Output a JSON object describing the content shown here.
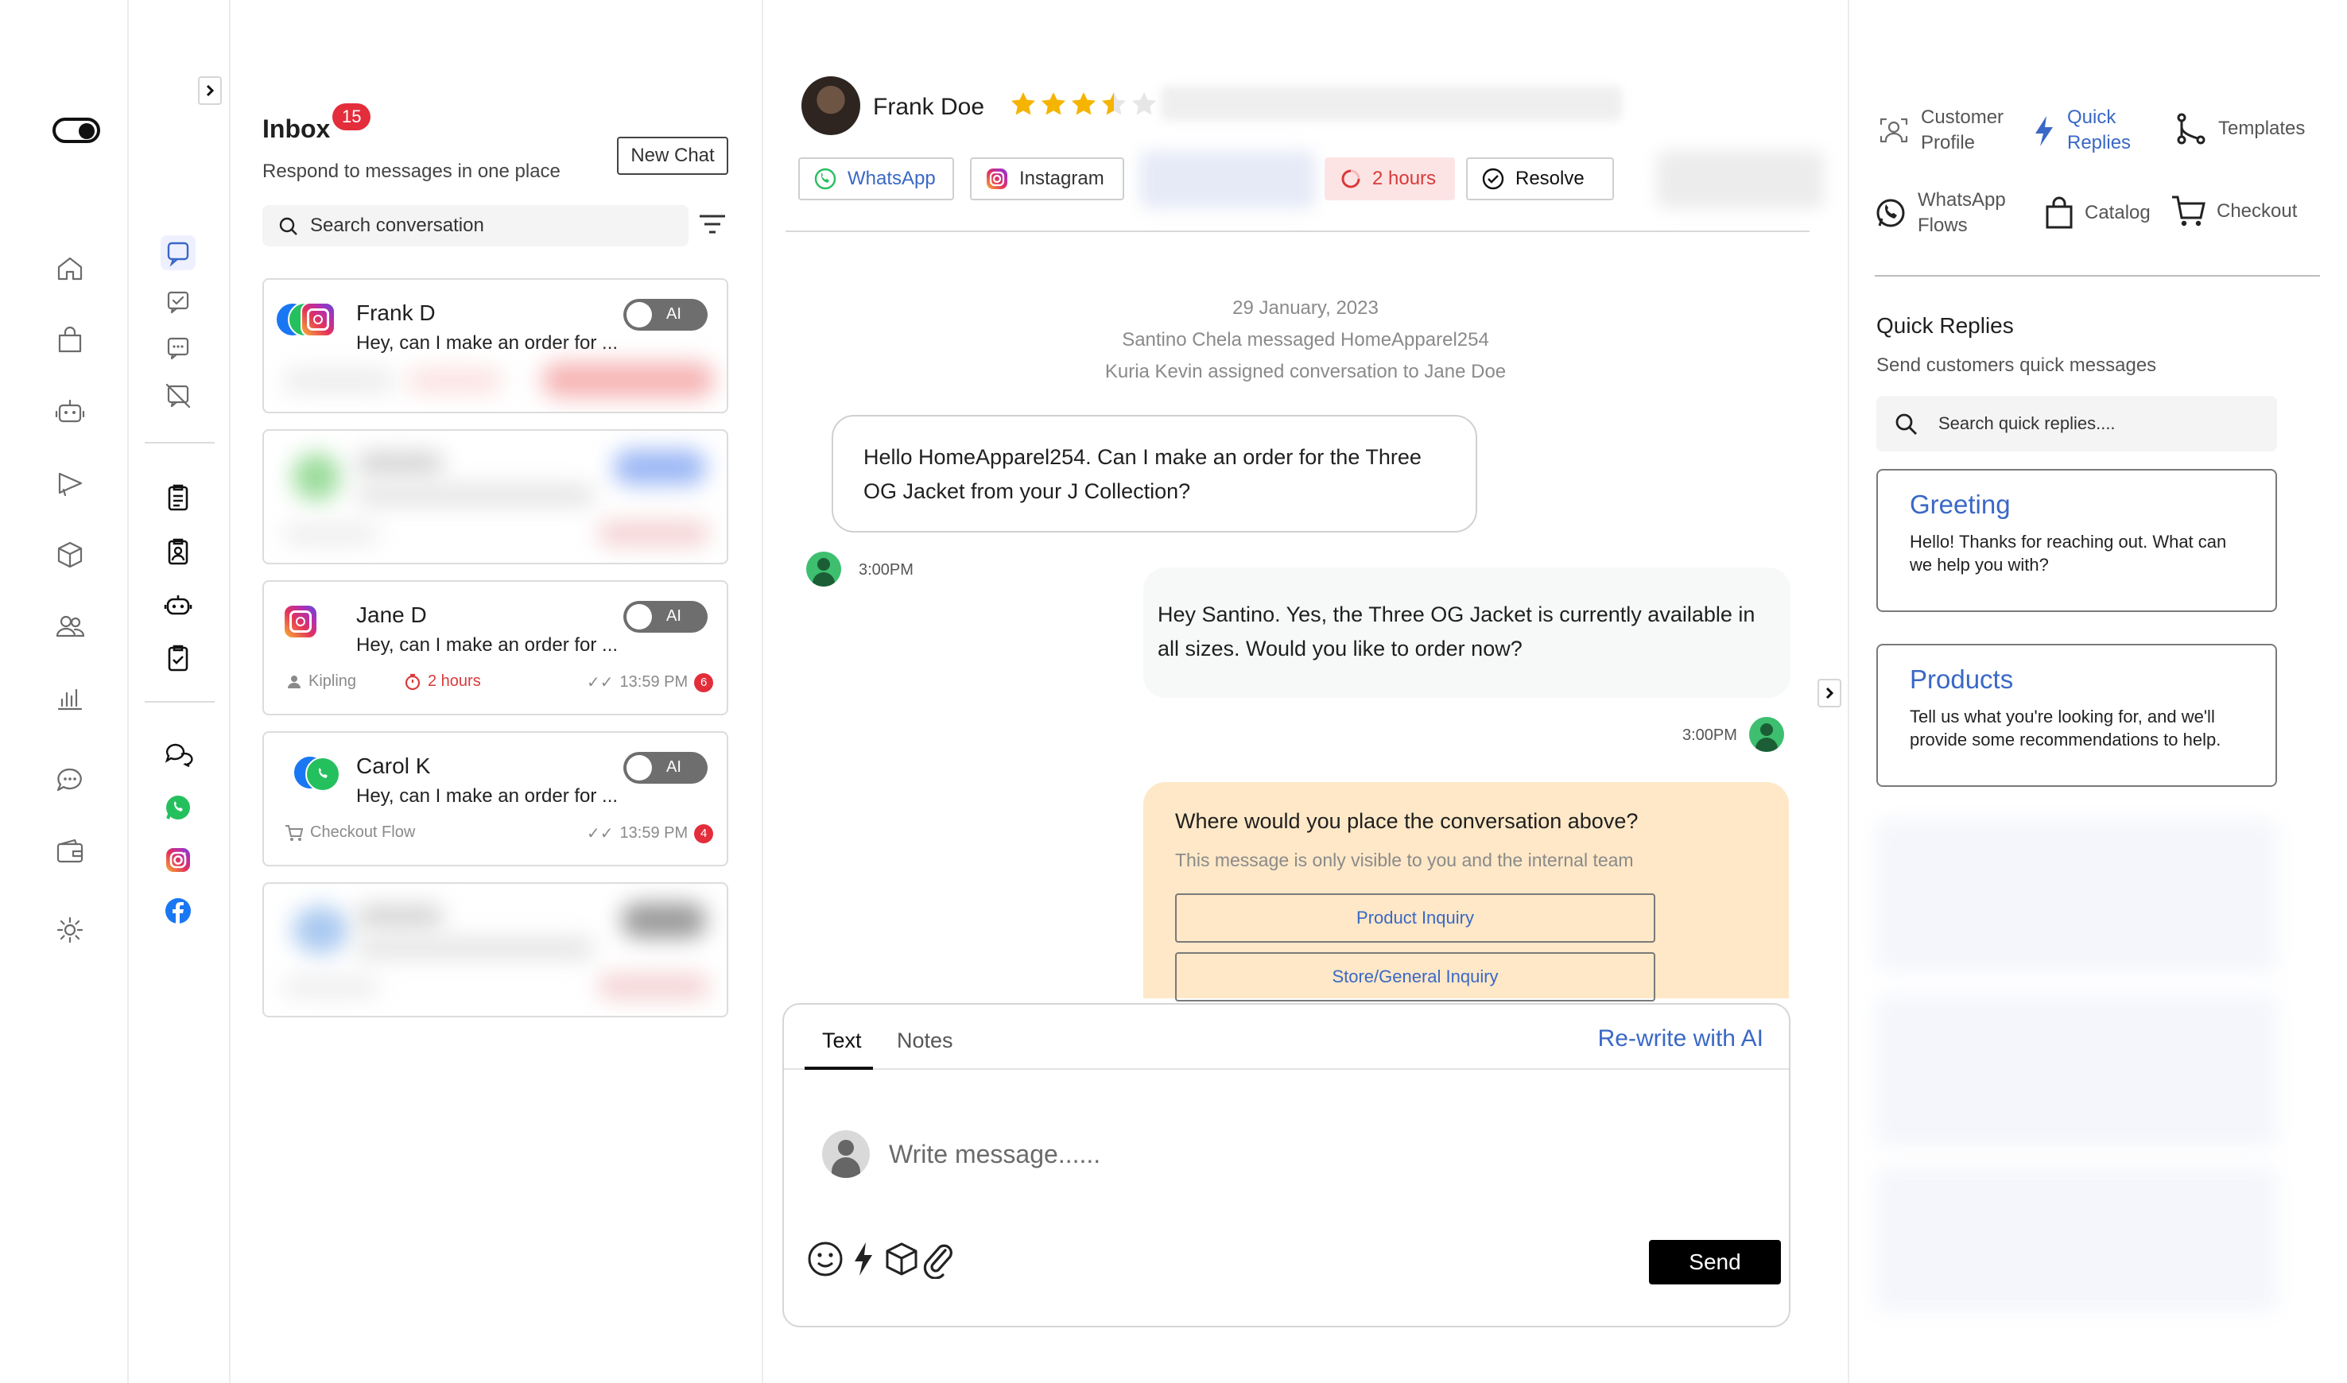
{
  "inbox": {
    "title": "Inbox",
    "badge": "15",
    "subtitle": "Respond to messages in one place",
    "new_chat_label": "New Chat",
    "search_placeholder": "Search  conversation",
    "conversations": [
      {
        "name": "Frank D",
        "preview": "Hey, can I make an order for ...",
        "ai_label": "AI",
        "channels": [
          "whatsapp",
          "facebook",
          "instagram"
        ]
      },
      {
        "name": "Jane D",
        "preview": "Hey, can I make an order for ...",
        "ai_label": "AI",
        "channel": "instagram",
        "agent": "Kipling",
        "wait": "2 hours",
        "time": "13:59 PM",
        "unread": "6"
      },
      {
        "name": "Carol K",
        "preview": "Hey, can I make an order for ...",
        "ai_label": "AI",
        "channels": [
          "facebook",
          "whatsapp"
        ],
        "flow": "Checkout Flow",
        "time": "13:59 PM",
        "unread": "4"
      }
    ]
  },
  "conversation": {
    "contact_name": "Frank Doe",
    "rating": 3.5,
    "rating_max": 5,
    "channels": {
      "whatsapp": "WhatsApp",
      "instagram": "Instagram"
    },
    "wait_time": "2 hours",
    "resolve_label": "Resolve",
    "system": {
      "date": "29 January, 2023",
      "line1": "Santino Chela messaged HomeApparel254",
      "line2": "Kuria Kevin assigned conversation to Jane Doe"
    },
    "messages": [
      {
        "direction": "in",
        "text": "Hello HomeApparel254. Can I make an order for the Three OG Jacket from your J Collection?",
        "time": "3:00PM"
      },
      {
        "direction": "out",
        "text": "Hey Santino. Yes, the Three OG Jacket is currently available in all sizes. Would you like to order now?",
        "time": "3:00PM"
      }
    ],
    "prompt": {
      "title": "Where would you place the conversation above?",
      "subtitle": "This message is only visible to you and the internal team",
      "options": [
        "Product Inquiry",
        "Store/General Inquiry"
      ]
    },
    "composer": {
      "tab_text": "Text",
      "tab_notes": "Notes",
      "rewrite_label": "Re-write with AI",
      "placeholder": "Write message......",
      "send_label": "Send"
    }
  },
  "panel": {
    "tools": {
      "customer_profile": [
        "Customer",
        "Profile"
      ],
      "quick_replies": [
        "Quick",
        "Replies"
      ],
      "templates": "Templates",
      "whatsapp_flows": [
        "WhatsApp",
        "Flows"
      ],
      "catalog": "Catalog",
      "checkout": "Checkout"
    },
    "quick_replies_title": "Quick Replies",
    "quick_replies_subtitle": "Send customers quick messages",
    "search_placeholder": "Search  quick replies....",
    "cards": [
      {
        "title": "Greeting",
        "text": "Hello! Thanks for reaching out. What can we help you with?"
      },
      {
        "title": "Products",
        "text": "Tell us what you're looking for, and we'll provide some recommendations to help."
      }
    ]
  },
  "colors": {
    "accent_blue": "#3a68c6",
    "alert_red": "#e32d3b",
    "prompt_bg": "#fee8c7",
    "whatsapp_green": "#25c05e",
    "star_gold": "#f5b400"
  }
}
